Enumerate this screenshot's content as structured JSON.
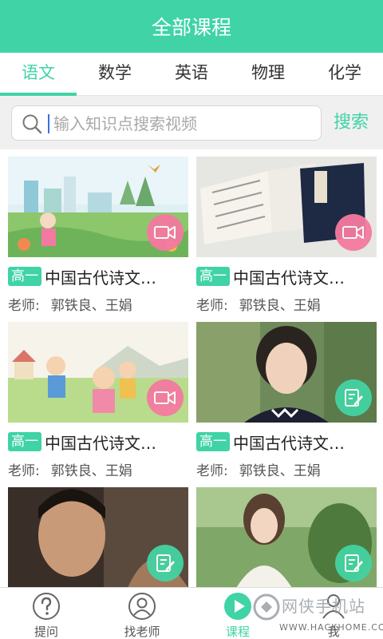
{
  "header": {
    "title": "全部课程"
  },
  "tabs": [
    {
      "label": "语文",
      "active": true
    },
    {
      "label": "数学",
      "active": false
    },
    {
      "label": "英语",
      "active": false
    },
    {
      "label": "物理",
      "active": false
    },
    {
      "label": "化学",
      "active": false
    }
  ],
  "search": {
    "placeholder": "输入知识点搜索视频",
    "button_label": "搜索"
  },
  "courses": [
    {
      "grade": "高一",
      "title": "中国古代诗文…",
      "teacher_label": "老师:",
      "teacher_name": "郭铁良、王娟",
      "badge": "video-camera-icon"
    },
    {
      "grade": "高一",
      "title": "中国古代诗文…",
      "teacher_label": "老师:",
      "teacher_name": "郭铁良、王娟",
      "badge": "video-camera-icon"
    },
    {
      "grade": "高一",
      "title": "中国古代诗文…",
      "teacher_label": "老师:",
      "teacher_name": "郭铁良、王娟",
      "badge": "video-camera-icon"
    },
    {
      "grade": "高一",
      "title": "中国古代诗文…",
      "teacher_label": "老师:",
      "teacher_name": "郭铁良、王娟",
      "badge": "edit-note-icon"
    },
    {
      "badge": "edit-note-icon"
    },
    {
      "badge": "edit-note-icon"
    }
  ],
  "bottom_nav": [
    {
      "label": "提问",
      "icon": "question-icon",
      "active": false
    },
    {
      "label": "找老师",
      "icon": "teacher-icon",
      "active": false
    },
    {
      "label": "课程",
      "icon": "play-icon",
      "active": true
    },
    {
      "label": "我",
      "icon": "user-icon",
      "active": false
    }
  ],
  "watermark": {
    "text": "网侠手机站",
    "url": "WWW.HACKHOME.COM"
  },
  "colors": {
    "accent": "#3fd3a6",
    "video_badge": "#f47aa0",
    "edit_badge": "#44d3a2"
  }
}
